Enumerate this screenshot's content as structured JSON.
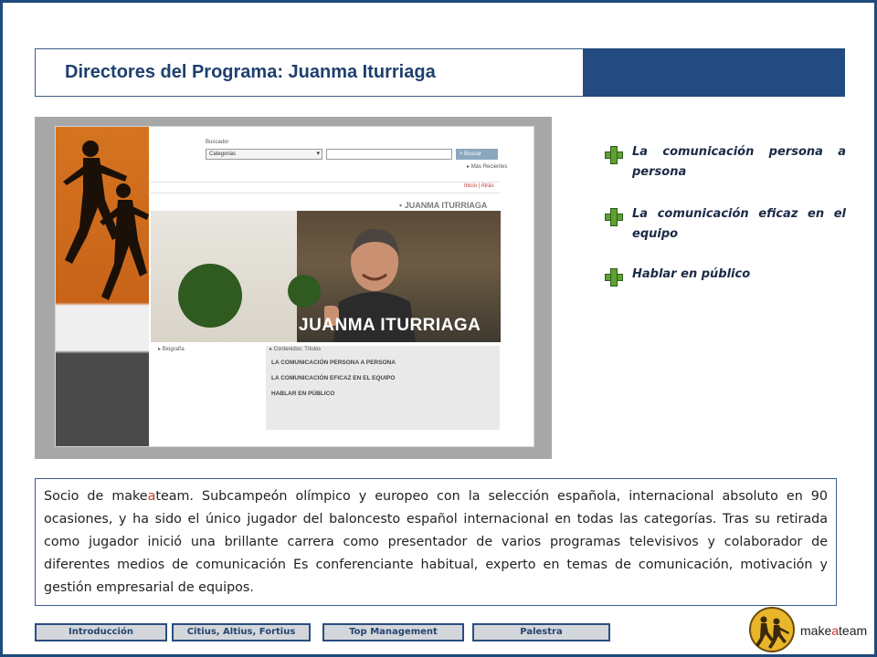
{
  "header": {
    "title": "Directores del Programa: Juanma Iturriaga"
  },
  "screenshot": {
    "search_label": "Buscador",
    "category_select": "Categorias",
    "search_button": "> Buscar",
    "recent_link": "Más Recientes",
    "breadcrumb": "Inicio | Atrás",
    "heading": "JUANMA ITURRIAGA",
    "photo_caption": "JUANMA ITURRIAGA",
    "bio_link": "Biografía",
    "contents_label": "Contenidos: Títulos",
    "topics": [
      "LA COMUNICACIÓN PERSONA A PERSONA",
      "LA COMUNICACIÓN EFICAZ EN EL EQUIPO",
      "HABLAR EN PÚBLICO"
    ]
  },
  "topics": [
    "La comunicación persona a persona",
    "La comunicación eficaz en el equipo",
    "Hablar en público"
  ],
  "bio": {
    "prefix": "Socio de make",
    "highlight": "a",
    "suffix": "team. Subcampeón olímpico y europeo con la selección española, internacional absoluto en 90 ocasiones, y ha sido el único jugador del baloncesto español internacional en todas las categorías. Tras su retirada como jugador inició una brillante carrera como presentador de varios programas televisivos y colaborador de diferentes medios de comunicación Es conferenciante habitual, experto en temas de comunicación, motivación y gestión empresarial de equipos."
  },
  "nav": {
    "items": [
      "Introducción",
      "Citius, Altius, Fortius",
      "Top Management",
      "Palestra"
    ]
  },
  "logo": {
    "prefix": "make",
    "highlight": "a",
    "suffix": "team"
  },
  "colors": {
    "frame": "#1f4a7c",
    "title": "#1f3f6e",
    "accent_block": "#234b82",
    "plus_icon": "#5fa032",
    "highlight_red": "#c0392b"
  }
}
